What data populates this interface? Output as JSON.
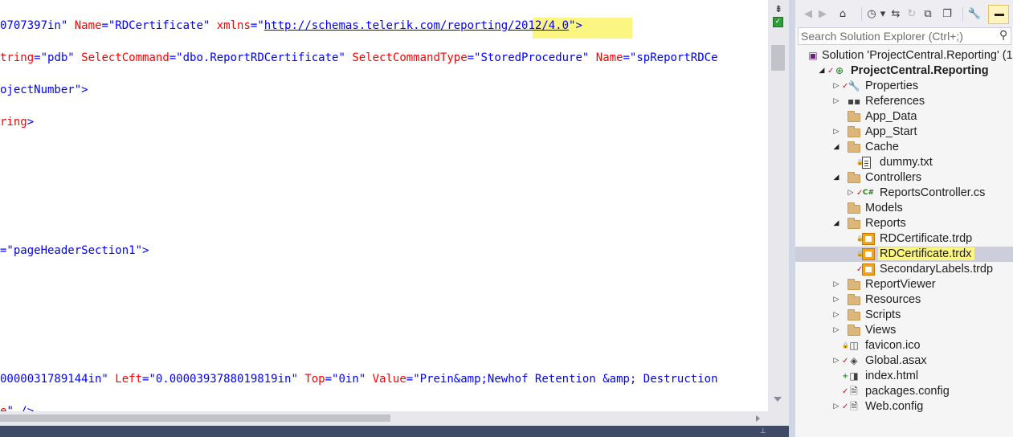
{
  "editor": {
    "lines": [
      [
        {
          "t": "0707397in\" ",
          "c": "xv"
        },
        {
          "t": "Name",
          "c": "xa"
        },
        {
          "t": "=\"",
          "c": "xv"
        },
        {
          "t": "RDCertificate",
          "c": "xv"
        },
        {
          "t": "\" ",
          "c": "xv"
        },
        {
          "t": "xmlns",
          "c": "xa"
        },
        {
          "t": "=\"",
          "c": "xv"
        },
        {
          "t": "http://schemas.telerik.com/reporting/2012/4.0",
          "c": "xl"
        },
        {
          "t": "\">",
          "c": "xv"
        }
      ],
      [
        {
          "t": "tring",
          "c": "xa"
        },
        {
          "t": "=\"pdb\" ",
          "c": "xv"
        },
        {
          "t": "SelectCommand",
          "c": "xa"
        },
        {
          "t": "=\"dbo.ReportRDCertificate\" ",
          "c": "xv"
        },
        {
          "t": "SelectCommandType",
          "c": "xa"
        },
        {
          "t": "=\"StoredProcedure\" ",
          "c": "xv"
        },
        {
          "t": "Name",
          "c": "xa"
        },
        {
          "t": "=\"spReportRDCe",
          "c": "xv"
        }
      ],
      [
        {
          "t": "ojectNumber\">",
          "c": "xv"
        }
      ],
      [
        {
          "t": "ring",
          "c": "xa"
        },
        {
          "t": ">",
          "c": "xv"
        }
      ],
      [],
      [],
      [],
      [
        {
          "t": "=\"pageHeaderSection1\">",
          "c": "xv"
        }
      ],
      [],
      [],
      [],
      [
        {
          "t": "0000031789144in\" ",
          "c": "xv"
        },
        {
          "t": "Left",
          "c": "xa"
        },
        {
          "t": "=\"0.0000393788019819in\" ",
          "c": "xv"
        },
        {
          "t": "Top",
          "c": "xa"
        },
        {
          "t": "=\"0in\" ",
          "c": "xv"
        },
        {
          "t": "Value",
          "c": "xa"
        },
        {
          "t": "=\"Prein&amp;Newhof Retention &amp; Destruction",
          "c": "xv"
        }
      ],
      [
        {
          "t": "e",
          "c": "xa"
        },
        {
          "t": "\" />",
          "c": "xv"
        }
      ]
    ],
    "split_icon": "split-view-icon",
    "status_icon": "no-issues-check-icon"
  },
  "solution_explorer": {
    "toolbar": [
      {
        "name": "back-icon",
        "glyph": "◀",
        "dim": true
      },
      {
        "name": "forward-icon",
        "glyph": "▶",
        "dim": true
      },
      {
        "name": "home-icon",
        "glyph": "⌂",
        "dim": false
      },
      {
        "name": "history-icon",
        "glyph": "◷",
        "dim": false
      },
      {
        "name": "dropdown-icon",
        "glyph": "▾",
        "dim": false
      },
      {
        "name": "sync-icon",
        "glyph": "⇆",
        "dim": false
      },
      {
        "name": "refresh-icon",
        "glyph": "↻",
        "dim": true
      },
      {
        "name": "collapse-all-icon",
        "glyph": "⧉",
        "dim": false
      },
      {
        "name": "show-all-files-icon",
        "glyph": "❐",
        "dim": false
      },
      {
        "name": "properties-wrench-icon",
        "glyph": "🔧",
        "dim": false
      }
    ],
    "search": {
      "placeholder": "Search Solution Explorer (Ctrl+;)",
      "value": ""
    },
    "tree": [
      {
        "label": "Solution 'ProjectCentral.Reporting' (1",
        "indent": 0,
        "expander": "",
        "state": "",
        "icon": "solution",
        "bold": false
      },
      {
        "label": "ProjectCentral.Reporting",
        "indent": 0,
        "expander": "open",
        "state": "check",
        "icon": "web-project",
        "bold": true
      },
      {
        "label": "Properties",
        "indent": 1,
        "expander": "closed",
        "state": "check",
        "icon": "wrench",
        "bold": false
      },
      {
        "label": "References",
        "indent": 1,
        "expander": "closed",
        "state": "",
        "icon": "references",
        "bold": false
      },
      {
        "label": "App_Data",
        "indent": 1,
        "expander": "",
        "state": "",
        "icon": "folder",
        "bold": false
      },
      {
        "label": "App_Start",
        "indent": 1,
        "expander": "closed",
        "state": "",
        "icon": "folder",
        "bold": false
      },
      {
        "label": "Cache",
        "indent": 1,
        "expander": "open",
        "state": "",
        "icon": "folder",
        "bold": false
      },
      {
        "label": "dummy.txt",
        "indent": 2,
        "expander": "",
        "state": "lock",
        "icon": "file",
        "bold": false
      },
      {
        "label": "Controllers",
        "indent": 1,
        "expander": "open",
        "state": "",
        "icon": "folder",
        "bold": false
      },
      {
        "label": "ReportsController.cs",
        "indent": 2,
        "expander": "closed",
        "state": "check",
        "icon": "csharp",
        "bold": false
      },
      {
        "label": "Models",
        "indent": 1,
        "expander": "",
        "state": "",
        "icon": "folder",
        "bold": false
      },
      {
        "label": "Reports",
        "indent": 1,
        "expander": "open",
        "state": "",
        "icon": "folder",
        "bold": false
      },
      {
        "label": "RDCertificate.trdp",
        "indent": 2,
        "expander": "",
        "state": "lock",
        "icon": "report",
        "bold": false
      },
      {
        "label": "RDCertificate.trdx",
        "indent": 2,
        "expander": "",
        "state": "lock",
        "icon": "report",
        "bold": false,
        "selected": true,
        "highlight": true
      },
      {
        "label": "SecondaryLabels.trdp",
        "indent": 2,
        "expander": "",
        "state": "check",
        "icon": "report",
        "bold": false
      },
      {
        "label": "ReportViewer",
        "indent": 1,
        "expander": "closed",
        "state": "",
        "icon": "folder",
        "bold": false
      },
      {
        "label": "Resources",
        "indent": 1,
        "expander": "closed",
        "state": "",
        "icon": "folder",
        "bold": false
      },
      {
        "label": "Scripts",
        "indent": 1,
        "expander": "closed",
        "state": "",
        "icon": "folder",
        "bold": false
      },
      {
        "label": "Views",
        "indent": 1,
        "expander": "closed",
        "state": "",
        "icon": "folder",
        "bold": false
      },
      {
        "label": "favicon.ico",
        "indent": 1,
        "expander": "",
        "state": "lock",
        "icon": "image",
        "bold": false
      },
      {
        "label": "Global.asax",
        "indent": 1,
        "expander": "closed",
        "state": "check",
        "icon": "global",
        "bold": false
      },
      {
        "label": "index.html",
        "indent": 1,
        "expander": "",
        "state": "plus",
        "icon": "html",
        "bold": false
      },
      {
        "label": "packages.config",
        "indent": 1,
        "expander": "",
        "state": "check",
        "icon": "config",
        "bold": false
      },
      {
        "label": "Web.config",
        "indent": 1,
        "expander": "closed",
        "state": "check",
        "icon": "config",
        "bold": false
      }
    ]
  },
  "colors": {
    "highlight": "#fbf681",
    "selection": "#cccedb",
    "xml_attribute": "#ff0000",
    "xml_value": "#0000ff",
    "folder": "#dcb67a",
    "report": "#f4a41b",
    "status_bar": "#3f4a66"
  }
}
